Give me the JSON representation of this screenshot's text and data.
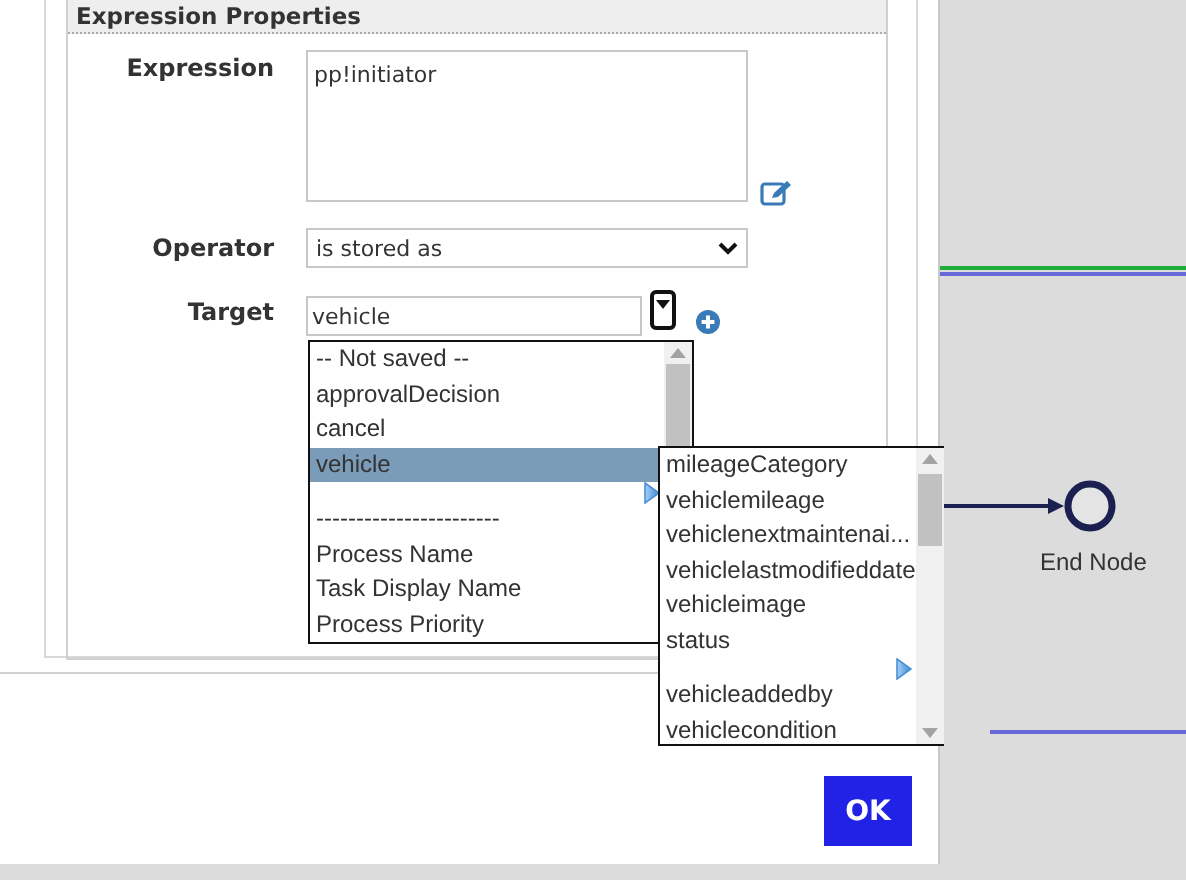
{
  "section": {
    "title": "Expression Properties"
  },
  "fields": [
    {
      "kind": "textarea",
      "label": "Expression",
      "value": "pp!initiator"
    },
    {
      "kind": "select",
      "label": "Operator",
      "value": "is stored as"
    },
    {
      "kind": "combo",
      "label": "Target",
      "value": "vehicle"
    }
  ],
  "target_list": [
    {
      "kind": "option",
      "label": "-- Not saved --",
      "selected": false
    },
    {
      "kind": "option",
      "label": "approvalDecision",
      "selected": false
    },
    {
      "kind": "option",
      "label": "cancel",
      "selected": false
    },
    {
      "kind": "option",
      "label": "vehicle",
      "selected": true
    },
    {
      "kind": "expander"
    },
    {
      "kind": "option",
      "label": "-----------------------",
      "selected": false
    },
    {
      "kind": "option",
      "label": "Process Name",
      "selected": false
    },
    {
      "kind": "option",
      "label": "Task Display Name",
      "selected": false
    },
    {
      "kind": "option",
      "label": "Process Priority",
      "selected": false
    }
  ],
  "sub_list": [
    {
      "kind": "option",
      "label": "mileageCategory",
      "selected": false
    },
    {
      "kind": "option",
      "label": "vehiclemileage",
      "selected": false
    },
    {
      "kind": "option",
      "label": "vehiclenextmaintenai...",
      "selected": false
    },
    {
      "kind": "option",
      "label": "vehiclelastmodifieddate",
      "selected": false
    },
    {
      "kind": "option",
      "label": "vehicleimage",
      "selected": false
    },
    {
      "kind": "option",
      "label": "status",
      "selected": false
    },
    {
      "kind": "expander"
    },
    {
      "kind": "option",
      "label": "vehicleaddedby",
      "selected": false
    },
    {
      "kind": "option",
      "label": "vehiclecondition",
      "selected": false
    }
  ],
  "ok_button": {
    "label": "OK"
  },
  "canvas": {
    "end_node": {
      "label": "End Node"
    }
  }
}
